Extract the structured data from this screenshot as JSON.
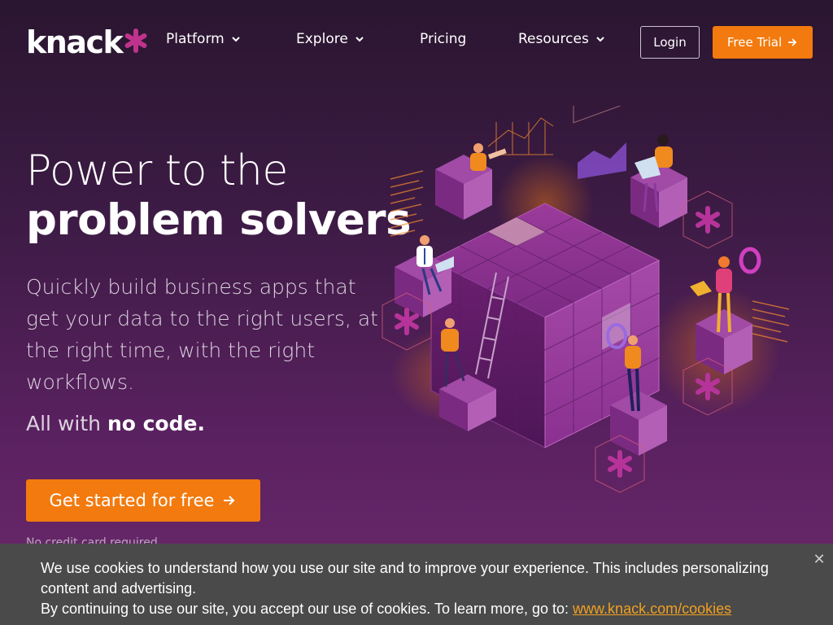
{
  "brand": {
    "name": "knack",
    "accent": "#f27a0e",
    "logo_star_color": "#c0338c"
  },
  "nav": {
    "items": [
      {
        "label": "Platform",
        "has_dropdown": true
      },
      {
        "label": "Explore",
        "has_dropdown": true
      },
      {
        "label": "Pricing",
        "has_dropdown": false
      },
      {
        "label": "Resources",
        "has_dropdown": true
      }
    ],
    "login_label": "Login",
    "trial_label": "Free Trial"
  },
  "hero": {
    "title_line1": "Power to the",
    "title_line2": "problem solvers",
    "description": "Quickly build business apps that get your data to the right users, at the right time, with the right workflows.",
    "nocode_prefix": "All with ",
    "nocode_bold": "no code.",
    "cta_label": "Get started for free",
    "no_cc": "No credit card required"
  },
  "cookie": {
    "text1": "We use cookies to understand how you use our site and to improve your experience. This includes personalizing content and advertising.",
    "text2": "By continuing to use our site, you accept our use of cookies. To learn more, go to: ",
    "link": "www.knack.com/cookies",
    "close_icon": "close-icon"
  }
}
